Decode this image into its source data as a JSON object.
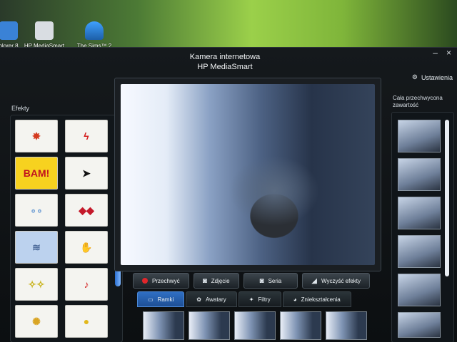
{
  "desktop": {
    "icons": [
      {
        "label": "plorer 8",
        "icon": "internet-explorer-icon"
      },
      {
        "label": "HP MediaSmart",
        "icon": "hp-mediasmart-icon"
      },
      {
        "label": "The Sims™ 2",
        "icon": "sims-icon"
      }
    ]
  },
  "window": {
    "title_line1": "Kamera internetowa",
    "title_line2": "HP MediaSmart",
    "minimize": "–",
    "close": "×",
    "settings_label": "Ustawienia"
  },
  "effects": {
    "label": "Efekty",
    "items": [
      "",
      "",
      "BAM!",
      "",
      "",
      "",
      "",
      "",
      "",
      "♪",
      "",
      ""
    ]
  },
  "actions": {
    "record": "Przechwyć",
    "photo": "Zdjęcie",
    "burst": "Seria",
    "clear": "Wyczyść efekty"
  },
  "tabs": [
    "Ramki",
    "Awatary",
    "Filtry",
    "Zniekształcenia"
  ],
  "captures": {
    "label": "Cała przechwycona zawartość"
  },
  "colors": {
    "accent": "#2f6fc4",
    "record": "#e0262b"
  }
}
